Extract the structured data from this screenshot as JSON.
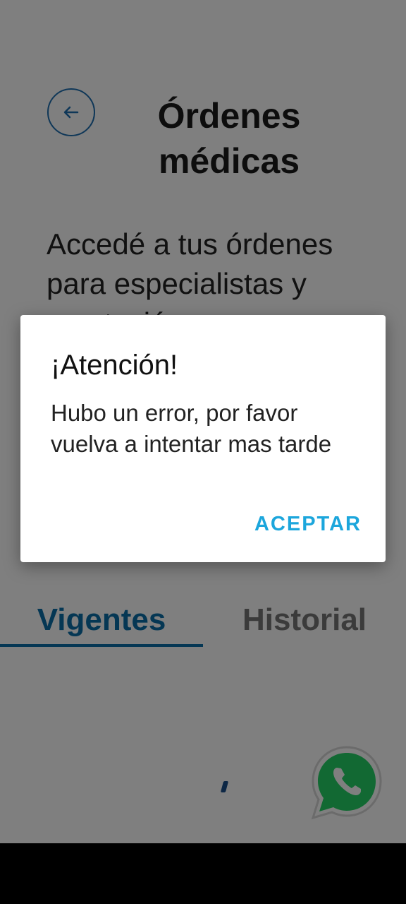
{
  "header": {
    "title": "Órdenes médicas"
  },
  "description": "Accedé a tus órdenes para especialistas y prestación",
  "tabs": [
    {
      "label": "Vigentes",
      "active": true
    },
    {
      "label": "Historial",
      "active": false
    }
  ],
  "dialog": {
    "title": "¡Atención!",
    "message": "Hubo un error, por favor vuelva a intentar mas tarde",
    "button_label": "ACEPTAR"
  },
  "colors": {
    "accent": "#0b6fa8",
    "dialog_button": "#1ca6dc",
    "whatsapp": "#25d366"
  },
  "icons": {
    "back": "arrow-left-circle-icon",
    "fab": "whatsapp-icon"
  }
}
